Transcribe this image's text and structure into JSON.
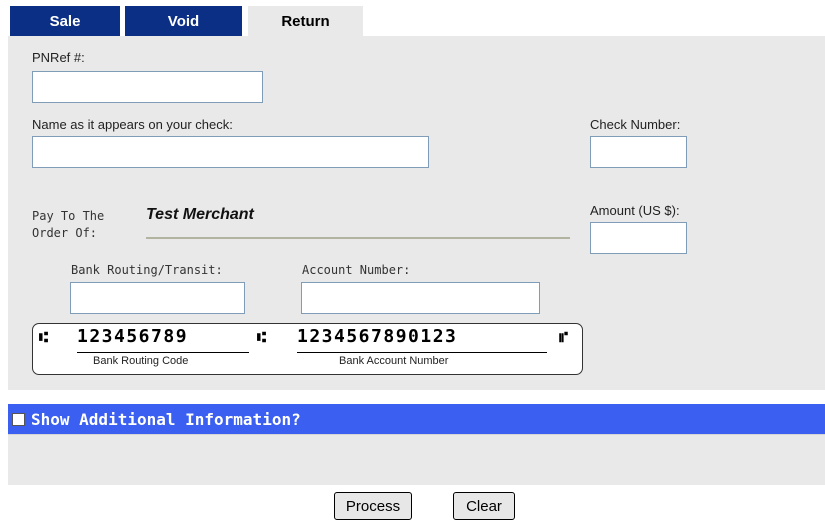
{
  "tabs": [
    {
      "label": "Sale",
      "active": false
    },
    {
      "label": "Void",
      "active": false
    },
    {
      "label": "Return",
      "active": true
    }
  ],
  "form": {
    "pnref_label": "PNRef #:",
    "pnref_value": "",
    "name_label": "Name as it appears on your check:",
    "name_value": "",
    "check_number_label": "Check Number:",
    "check_number_value": "",
    "pay_to_line1": "Pay To The",
    "pay_to_line2": "Order Of:",
    "merchant_name": "Test Merchant",
    "amount_label": "Amount (US $):",
    "amount_value": "",
    "routing_label": "Bank Routing/Transit:",
    "routing_value": "",
    "account_label": "Account Number:",
    "account_value": ""
  },
  "micr": {
    "transit_symbol": "⑆",
    "routing_digits": "123456789",
    "account_digits": "1234567890123",
    "on_us_symbol": "⑈",
    "routing_caption": "Bank Routing Code",
    "account_caption": "Bank Account Number"
  },
  "additional": {
    "label": "Show Additional Information?",
    "checked": false
  },
  "buttons": {
    "process_label": "Process",
    "clear_label": "Clear"
  },
  "colors": {
    "tab_inactive": "#0c2f86",
    "panel_bg": "#e9e9e9",
    "accent_bar": "#3b5ff0"
  },
  "icons": {
    "checkbox": "checkbox-icon",
    "micr_transit": "micr-transit-symbol-icon",
    "micr_on_us": "micr-on-us-symbol-icon"
  }
}
